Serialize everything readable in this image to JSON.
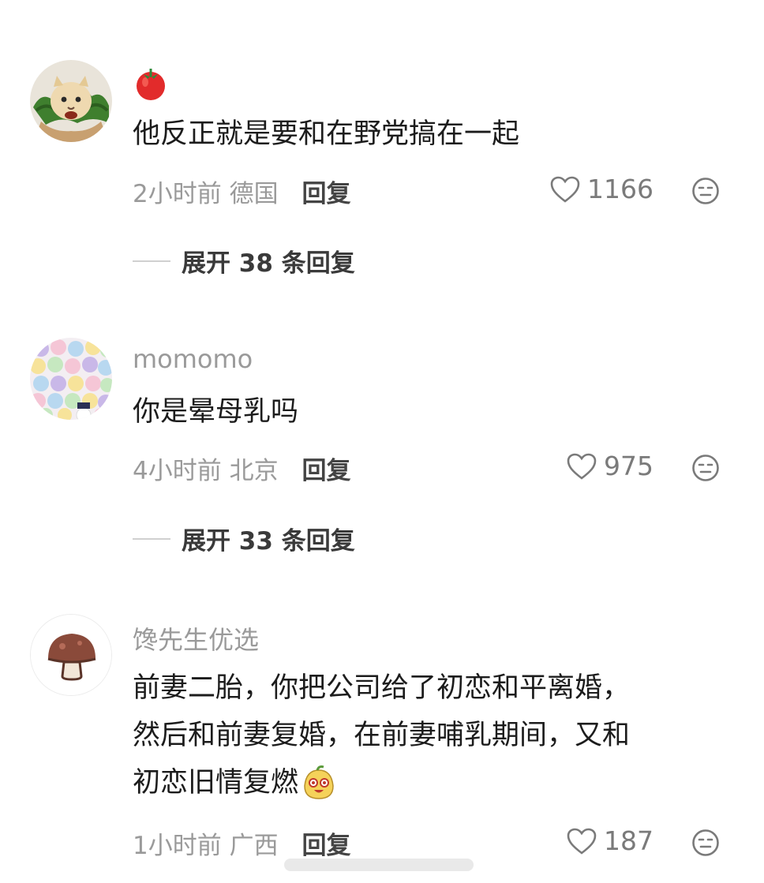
{
  "comments": [
    {
      "username": "",
      "username_emoji": "tomato",
      "avatar_icon": "cat-lettuce-avatar",
      "text": "他反正就是要和在野党搞在一起",
      "time": "2小时前",
      "location": "德国",
      "reply_label": "回复",
      "likes": "1166",
      "expand_label": "展开 38 条回复"
    },
    {
      "username": "momomo",
      "avatar_icon": "cartoon-crowd-avatar",
      "text": "你是晕母乳吗",
      "time": "4小时前",
      "location": "北京",
      "reply_label": "回复",
      "likes": "975",
      "expand_label": "展开 33 条回复"
    },
    {
      "username": "馋先生优选",
      "avatar_icon": "mushroom-avatar",
      "text_lines": [
        "前妻二胎，你把公司给了初恋和平离婚，",
        "然后和前妻复婚，在前妻哺乳期间，又和",
        "初恋旧情复燃"
      ],
      "text_emoji": "smiling-bun-emoji",
      "time": "1小时前",
      "location": "广西",
      "reply_label": "回复",
      "likes": "187"
    }
  ],
  "colors": {
    "secondary_text": "#9a9a9a",
    "primary_text": "#1c1c1c",
    "icon_gray": "#7a7a7a"
  }
}
